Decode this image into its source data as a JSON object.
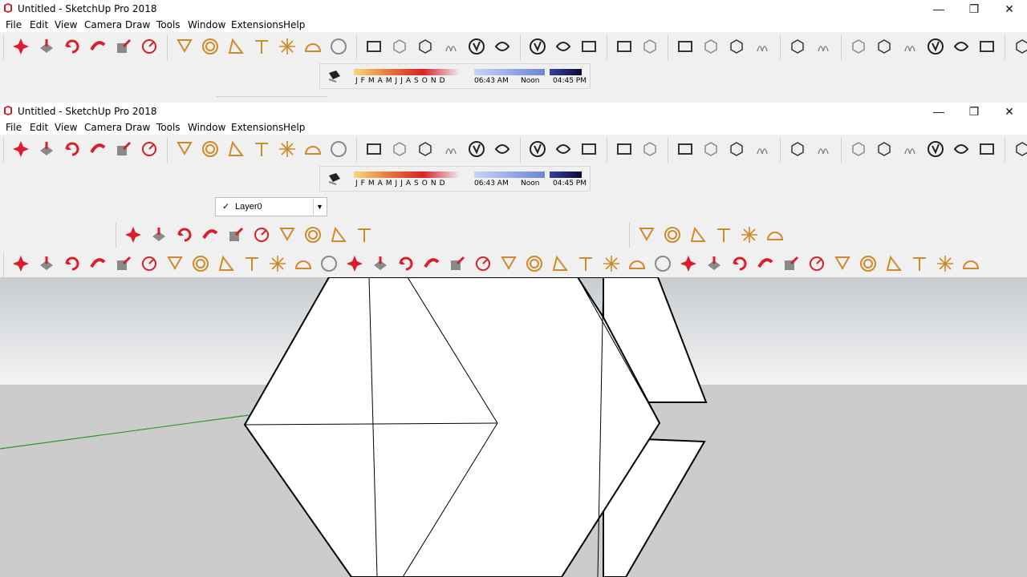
{
  "window_back": {
    "title": "Untitled - SketchUp Pro 2018",
    "menu": [
      "File",
      "Edit",
      "View",
      "Camera",
      "Draw",
      "Tools",
      "Window",
      "Extensions",
      "Help"
    ],
    "minimize": "—",
    "restore": "❐",
    "close": "✕"
  },
  "window_front": {
    "title": "Untitled - SketchUp Pro 2018",
    "menu": [
      "File",
      "Edit",
      "View",
      "Camera",
      "Draw",
      "Tools",
      "Window",
      "Extensions",
      "Help"
    ],
    "minimize": "—",
    "restore": "❐",
    "close": "✕"
  },
  "shadows": {
    "months": [
      "J",
      "F",
      "M",
      "A",
      "M",
      "J",
      "J",
      "A",
      "S",
      "O",
      "N",
      "D"
    ],
    "time_start": "06:43 AM",
    "time_mid": "Noon",
    "time_end": "04:45 PM"
  },
  "layers": {
    "current": "Layer0",
    "check": "✓",
    "dropdown": "▼"
  },
  "colors": {
    "sky_top": "#c8ccd0",
    "sky_bottom": "#f2f3f4",
    "ground": "#cccccc",
    "green_axis": "#2a9a2a",
    "icon_red": "#d9202a",
    "icon_orange": "#d08a2a",
    "icon_blue": "#2b7bd4",
    "icon_gray": "#8a8a8a"
  },
  "icons": {
    "standard": [
      "move-icon",
      "pushpull-icon",
      "rotate-icon",
      "followme-icon",
      "scale-icon",
      "offset-icon"
    ],
    "construction": [
      "tape-icon",
      "circle-icon",
      "protractor-icon",
      "dimension-icon",
      "axes-icon",
      "text-icon",
      "sphere-icon"
    ],
    "warehouse": [
      "warehouse-icon",
      "extension-icon",
      "upload-icon",
      "sandbox-icon",
      "drape-icon",
      "stamp-icon"
    ],
    "views": [
      "v-ray-icon",
      "teapot-icon",
      "teapot-cursor-icon"
    ],
    "render": [
      "render-icon",
      "render-settings-icon"
    ],
    "misc": [
      "frame-icon",
      "light-icon",
      "cloud-icon",
      "lock-icon"
    ],
    "section": [
      "section-plane-icon",
      "section-fill-icon"
    ],
    "styles": [
      "xray-icon",
      "backedge-icon",
      "wireframe-icon",
      "hidden-icon",
      "shaded-icon",
      "monochrome-icon"
    ],
    "scenes": [
      "scene-cursor-icon"
    ],
    "draw": [
      "pencil-icon",
      "freehand-icon",
      "rectangle-icon",
      "rotated-rectangle-icon",
      "circle-draw-icon",
      "polygon-icon",
      "arc-icon",
      "two-point-arc-icon",
      "three-point-arc-icon",
      "pie-icon"
    ],
    "measure": [
      "tape-measure-icon",
      "dimensions-icon",
      "protractor-measure-icon",
      "text-label-icon",
      "axes-measure-icon",
      "3d-text-icon"
    ]
  }
}
